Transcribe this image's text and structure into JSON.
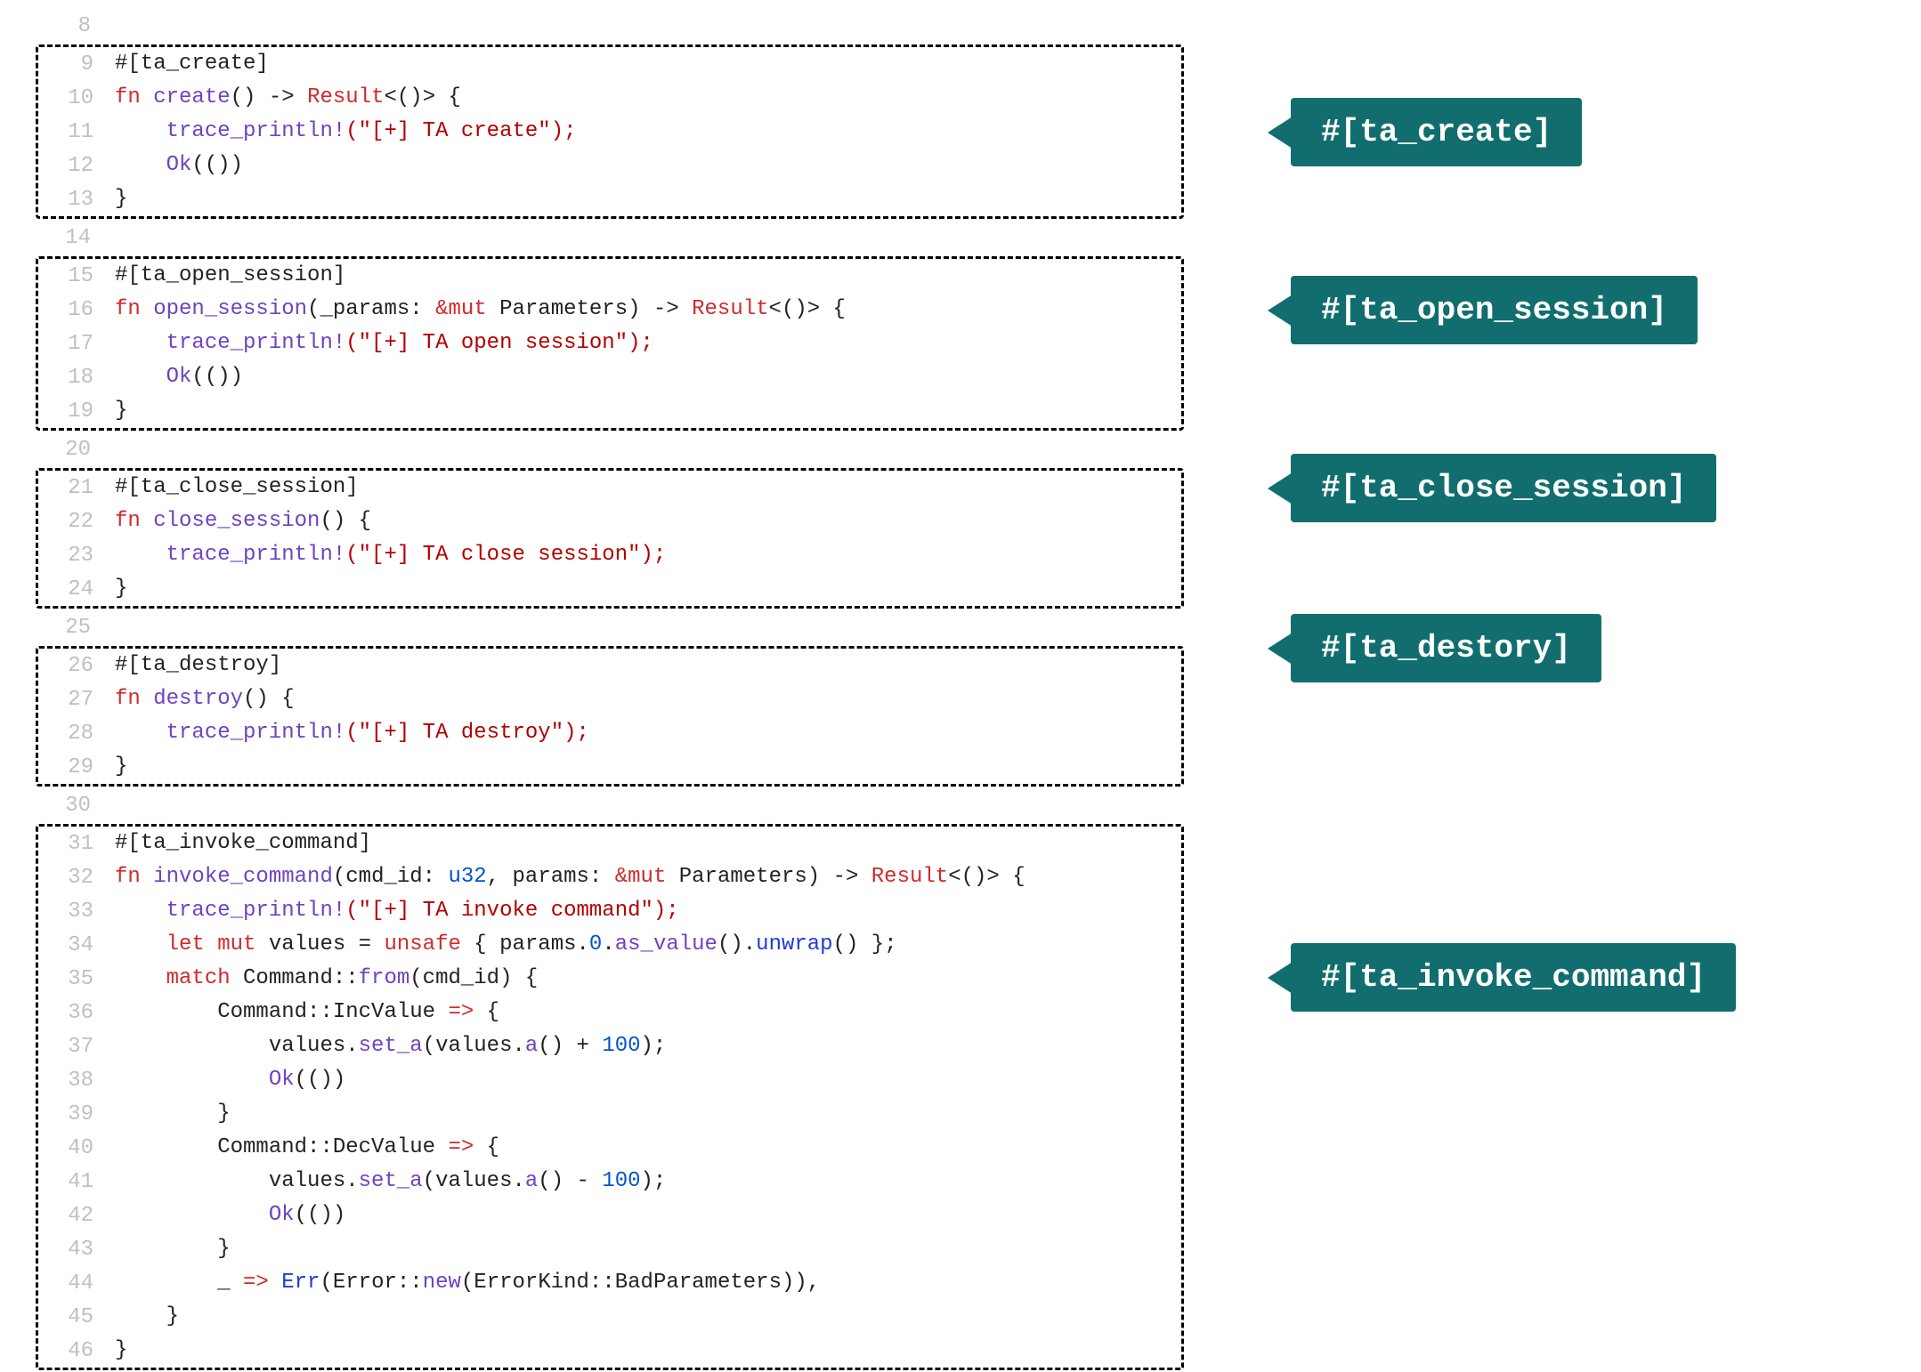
{
  "colors": {
    "chip_bg": "#126e6e",
    "chip_fg": "#ffffff"
  },
  "chips": {
    "create": "#[ta_create]",
    "open": "#[ta_open_session]",
    "close": "#[ta_close_session]",
    "destroy": "#[ta_destory]",
    "invoke": "#[ta_invoke_command]"
  },
  "gutter": {
    "l8": "8",
    "l9": "9",
    "l10": "10",
    "l11": "11",
    "l12": "12",
    "l13": "13",
    "l14": "14",
    "l15": "15",
    "l16": "16",
    "l17": "17",
    "l18": "18",
    "l19": "19",
    "l20": "20",
    "l21": "21",
    "l22": "22",
    "l23": "23",
    "l24": "24",
    "l25": "25",
    "l26": "26",
    "l27": "27",
    "l28": "28",
    "l29": "29",
    "l30": "30",
    "l31": "31",
    "l32": "32",
    "l33": "33",
    "l34": "34",
    "l35": "35",
    "l36": "36",
    "l37": "37",
    "l38": "38",
    "l39": "39",
    "l40": "40",
    "l41": "41",
    "l42": "42",
    "l43": "43",
    "l44": "44",
    "l45": "45",
    "l46": "46"
  },
  "code": {
    "attr_ta_create": "#[ta_create]",
    "fn": "fn",
    "create_name": " create",
    "paren_empty": "()",
    "arrow": " -> ",
    "result": "Result",
    "angle_unit": "<()>",
    "brace_open": " {",
    "brace_close": "}",
    "indent1": "    ",
    "indent2": "        ",
    "indent3": "            ",
    "trace_println": "trace_println!",
    "trace_ta_create": "(\"[+] TA create\");",
    "ok_unit": "Ok",
    "ok_tail": "(())",
    "attr_ta_open": "#[ta_open_session]",
    "open_session_name": " open_session",
    "open_session_sig_a": "(_params: ",
    "amp_mut": "&mut",
    "open_session_sig_b": " Parameters)",
    "trace_ta_open": "(\"[+] TA open session\");",
    "attr_ta_close": "#[ta_close_session]",
    "close_session_name": " close_session",
    "close_session_sig": "() {",
    "trace_ta_close": "(\"[+] TA close session\");",
    "attr_ta_destroy": "#[ta_destroy]",
    "destroy_name": " destroy",
    "destroy_sig": "() {",
    "trace_ta_destroy": "(\"[+] TA destroy\");",
    "attr_ta_invoke": "#[ta_invoke_command]",
    "invoke_name": " invoke_command",
    "invoke_sig_a": "(cmd_id: ",
    "u32": "u32",
    "invoke_sig_b": ", params: ",
    "invoke_sig_c": " Parameters)",
    "trace_ta_invoke": "(\"[+] TA invoke command\");",
    "let": "let",
    "mut": " mut",
    "values_eq": " values = ",
    "unsafe": "unsafe",
    "unsafe_body_a": " { params.",
    "zero": "0",
    "unsafe_body_b": ".",
    "as_value": "as_value",
    "unsafe_body_c": "().",
    "unwrap": "unwrap",
    "unsafe_body_d": "() };",
    "match": "match",
    "match_expr": " Command::",
    "from": "from",
    "match_expr2": "(cmd_id) {",
    "case_inc": "Command::IncValue ",
    "fat_arrow": "=>",
    "case_open": " {",
    "values_set_a": "values.",
    "set_a": "set_a",
    "inc_args_a": "(values.",
    "a_call": "a",
    "inc_args_b": "() + ",
    "hundred": "100",
    "inc_args_c": ");",
    "case_dec": "Command::DecValue ",
    "dec_args_b": "() - ",
    "underscore": "_ ",
    "err": "Err",
    "err_args_a": "(Error::",
    "new": "new",
    "err_args_b": "(ErrorKind::BadParameters)),"
  }
}
